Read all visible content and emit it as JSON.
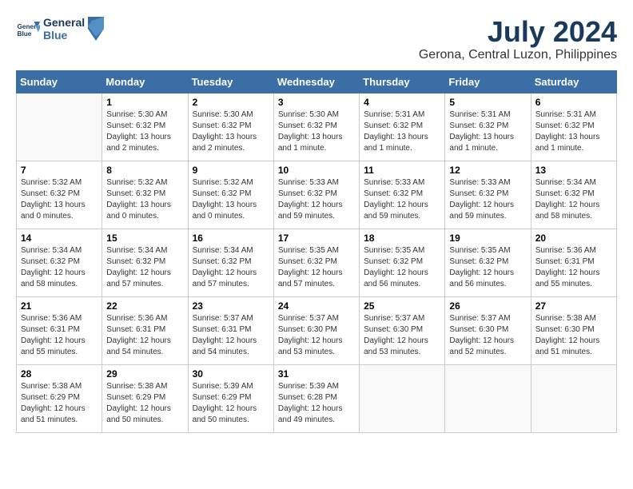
{
  "header": {
    "logo_line1": "General",
    "logo_line2": "Blue",
    "month_year": "July 2024",
    "location": "Gerona, Central Luzon, Philippines"
  },
  "days_of_week": [
    "Sunday",
    "Monday",
    "Tuesday",
    "Wednesday",
    "Thursday",
    "Friday",
    "Saturday"
  ],
  "weeks": [
    [
      {
        "day": "",
        "empty": true
      },
      {
        "day": "1",
        "sunrise": "5:30 AM",
        "sunset": "6:32 PM",
        "daylight": "13 hours and 2 minutes."
      },
      {
        "day": "2",
        "sunrise": "5:30 AM",
        "sunset": "6:32 PM",
        "daylight": "13 hours and 2 minutes."
      },
      {
        "day": "3",
        "sunrise": "5:30 AM",
        "sunset": "6:32 PM",
        "daylight": "13 hours and 1 minute."
      },
      {
        "day": "4",
        "sunrise": "5:31 AM",
        "sunset": "6:32 PM",
        "daylight": "13 hours and 1 minute."
      },
      {
        "day": "5",
        "sunrise": "5:31 AM",
        "sunset": "6:32 PM",
        "daylight": "13 hours and 1 minute."
      },
      {
        "day": "6",
        "sunrise": "5:31 AM",
        "sunset": "6:32 PM",
        "daylight": "13 hours and 1 minute."
      }
    ],
    [
      {
        "day": "7",
        "sunrise": "5:32 AM",
        "sunset": "6:32 PM",
        "daylight": "13 hours and 0 minutes."
      },
      {
        "day": "8",
        "sunrise": "5:32 AM",
        "sunset": "6:32 PM",
        "daylight": "13 hours and 0 minutes."
      },
      {
        "day": "9",
        "sunrise": "5:32 AM",
        "sunset": "6:32 PM",
        "daylight": "13 hours and 0 minutes."
      },
      {
        "day": "10",
        "sunrise": "5:33 AM",
        "sunset": "6:32 PM",
        "daylight": "12 hours and 59 minutes."
      },
      {
        "day": "11",
        "sunrise": "5:33 AM",
        "sunset": "6:32 PM",
        "daylight": "12 hours and 59 minutes."
      },
      {
        "day": "12",
        "sunrise": "5:33 AM",
        "sunset": "6:32 PM",
        "daylight": "12 hours and 59 minutes."
      },
      {
        "day": "13",
        "sunrise": "5:34 AM",
        "sunset": "6:32 PM",
        "daylight": "12 hours and 58 minutes."
      }
    ],
    [
      {
        "day": "14",
        "sunrise": "5:34 AM",
        "sunset": "6:32 PM",
        "daylight": "12 hours and 58 minutes."
      },
      {
        "day": "15",
        "sunrise": "5:34 AM",
        "sunset": "6:32 PM",
        "daylight": "12 hours and 57 minutes."
      },
      {
        "day": "16",
        "sunrise": "5:34 AM",
        "sunset": "6:32 PM",
        "daylight": "12 hours and 57 minutes."
      },
      {
        "day": "17",
        "sunrise": "5:35 AM",
        "sunset": "6:32 PM",
        "daylight": "12 hours and 57 minutes."
      },
      {
        "day": "18",
        "sunrise": "5:35 AM",
        "sunset": "6:32 PM",
        "daylight": "12 hours and 56 minutes."
      },
      {
        "day": "19",
        "sunrise": "5:35 AM",
        "sunset": "6:32 PM",
        "daylight": "12 hours and 56 minutes."
      },
      {
        "day": "20",
        "sunrise": "5:36 AM",
        "sunset": "6:31 PM",
        "daylight": "12 hours and 55 minutes."
      }
    ],
    [
      {
        "day": "21",
        "sunrise": "5:36 AM",
        "sunset": "6:31 PM",
        "daylight": "12 hours and 55 minutes."
      },
      {
        "day": "22",
        "sunrise": "5:36 AM",
        "sunset": "6:31 PM",
        "daylight": "12 hours and 54 minutes."
      },
      {
        "day": "23",
        "sunrise": "5:37 AM",
        "sunset": "6:31 PM",
        "daylight": "12 hours and 54 minutes."
      },
      {
        "day": "24",
        "sunrise": "5:37 AM",
        "sunset": "6:30 PM",
        "daylight": "12 hours and 53 minutes."
      },
      {
        "day": "25",
        "sunrise": "5:37 AM",
        "sunset": "6:30 PM",
        "daylight": "12 hours and 53 minutes."
      },
      {
        "day": "26",
        "sunrise": "5:37 AM",
        "sunset": "6:30 PM",
        "daylight": "12 hours and 52 minutes."
      },
      {
        "day": "27",
        "sunrise": "5:38 AM",
        "sunset": "6:30 PM",
        "daylight": "12 hours and 51 minutes."
      }
    ],
    [
      {
        "day": "28",
        "sunrise": "5:38 AM",
        "sunset": "6:29 PM",
        "daylight": "12 hours and 51 minutes."
      },
      {
        "day": "29",
        "sunrise": "5:38 AM",
        "sunset": "6:29 PM",
        "daylight": "12 hours and 50 minutes."
      },
      {
        "day": "30",
        "sunrise": "5:39 AM",
        "sunset": "6:29 PM",
        "daylight": "12 hours and 50 minutes."
      },
      {
        "day": "31",
        "sunrise": "5:39 AM",
        "sunset": "6:28 PM",
        "daylight": "12 hours and 49 minutes."
      },
      {
        "day": "",
        "empty": true
      },
      {
        "day": "",
        "empty": true
      },
      {
        "day": "",
        "empty": true
      }
    ]
  ]
}
